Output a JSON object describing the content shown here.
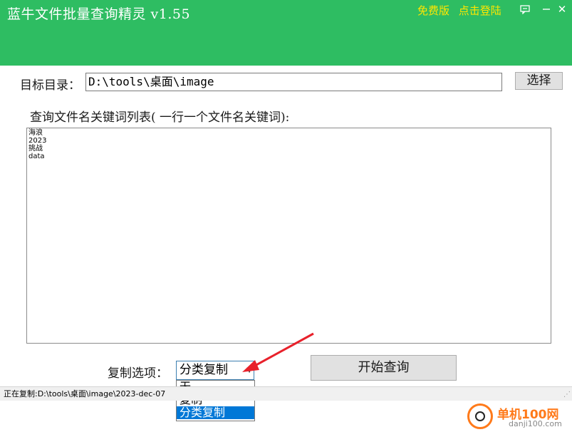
{
  "window": {
    "title": "蓝牛文件批量查询精灵  v1.55",
    "links": [
      "免费版",
      "点击登陆"
    ],
    "controls": {
      "feedback_icon": "message-icon",
      "close_glyph": "✕"
    }
  },
  "form": {
    "dir_label": "目标目录：",
    "dir_value": "D:\\tools\\桌面\\image",
    "browse_label": "选择",
    "keywords_label": "查询文件名关键词列表( 一行一个文件名关键词):",
    "keywords": [
      "海浪",
      "2023",
      "挑战",
      "data"
    ],
    "copy_label": "复制选项：",
    "copy_selected": "分类复制",
    "copy_options": [
      "无",
      "复制",
      "分类复制"
    ],
    "start_label": "开始查询"
  },
  "status": {
    "text": "正在复制:D:\\tools\\桌面\\image\\2023-dec-07"
  },
  "watermark": {
    "brand": "单机100网",
    "url": "danji100.com"
  },
  "colors": {
    "titlebar": "#2ebd62",
    "title_link": "#ffe600",
    "selection": "#0078d7",
    "arrow": "#e8212b"
  }
}
